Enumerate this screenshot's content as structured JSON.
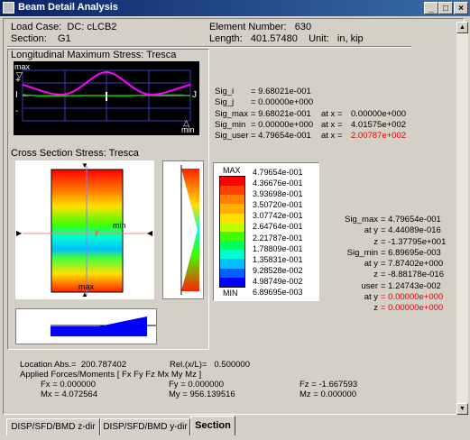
{
  "window": {
    "title": "Beam Detail Analysis",
    "min": "_",
    "max": "□",
    "close": "×"
  },
  "header": {
    "load_case_label": "Load Case:",
    "load_case_value": "DC: cLCB2",
    "section_label": "Section:",
    "section_value": "G1",
    "element_label": "Element Number:",
    "element_value": "630",
    "length_label": "Length:",
    "length_value": "401.57480",
    "unit_label": "Unit:",
    "unit_value": "in, kip"
  },
  "long_plot": {
    "title": "Longitudinal Maximum Stress: Tresca",
    "max_label": "max",
    "min_label": "min",
    "plus": "+",
    "minus": "-",
    "i_label": "I",
    "j_label": "J"
  },
  "sig_values": [
    {
      "name": "Sig_i",
      "value": "= 9.68021e-001",
      "at_x_label": "",
      "at_x_value": "",
      "red": false
    },
    {
      "name": "Sig_j",
      "value": "= 0.00000e+000",
      "at_x_label": "",
      "at_x_value": "",
      "red": false
    },
    {
      "name": "Sig_max",
      "value": "= 9.68021e-001",
      "at_x_label": "at x =",
      "at_x_value": "0.00000e+000",
      "red": false
    },
    {
      "name": "Sig_min",
      "value": "= 0.00000e+000",
      "at_x_label": "at x =",
      "at_x_value": "4.01575e+002",
      "red": false
    },
    {
      "name": "Sig_user",
      "value": "= 4.79654e-001",
      "at_x_label": "at x =",
      "at_x_value": "2.00787e+002",
      "red": true
    }
  ],
  "cross_section": {
    "title": "Cross Section Stress: Tresca",
    "min_label": "min",
    "max_label": "max",
    "y_label": "y"
  },
  "legend": {
    "max_label": "MAX",
    "min_label": "MIN",
    "values": [
      "4.79654e-001",
      "4.36676e-001",
      "3.93698e-001",
      "3.50720e-001",
      "3.07742e-001",
      "2.64764e-001",
      "2.21787e-001",
      "1.78809e-001",
      "1.35831e-001",
      "9.28528e-002",
      "4.98749e-002",
      "6.89695e-003"
    ],
    "colors": [
      "#ff0000",
      "#ff4000",
      "#ff8000",
      "#ffb000",
      "#ffe000",
      "#c0ff00",
      "#40ff00",
      "#00ff60",
      "#00ffd0",
      "#00c0ff",
      "#0060ff",
      "#0000ff"
    ]
  },
  "stats": [
    {
      "label": "Sig_max",
      "value": "= 4.79654e-001",
      "red": false
    },
    {
      "label": "at y",
      "value": "= 4.44089e-016",
      "red": false
    },
    {
      "label": "z",
      "value": "= -1.37795e+001",
      "red": false
    },
    {
      "label": "Sig_min",
      "value": "= 6.89695e-003",
      "red": false
    },
    {
      "label": "at y",
      "value": "= 7.87402e+000",
      "red": false
    },
    {
      "label": "z",
      "value": "= -8.88178e-016",
      "red": false
    },
    {
      "label": "user",
      "value": "= 1.24743e-002",
      "red": false
    },
    {
      "label": "at y",
      "value": "= 0.00000e+000",
      "red": true
    },
    {
      "label": "z",
      "value": "= 0.00000e+000",
      "red": true
    }
  ],
  "location": {
    "abs_label": "Location Abs.=",
    "abs_value": "200.787402",
    "rel_label": "Rel.(x/L)=",
    "rel_value": "0.500000",
    "forces_label": "Applied Forces/Moments [ Fx Fy Fz Mx My Mz ]",
    "fx": "Fx = 0.000000",
    "fy": "Fy = 0.000000",
    "fz": "Fz = -1.667593",
    "mx": "Mx = 4.072564",
    "my": "My = 956.139516",
    "mz": "Mz = 0.000000"
  },
  "tabs": [
    {
      "label": "DISP/SFD/BMD z-dir"
    },
    {
      "label": "DISP/SFD/BMD y-dir"
    },
    {
      "label": "Section"
    }
  ]
}
